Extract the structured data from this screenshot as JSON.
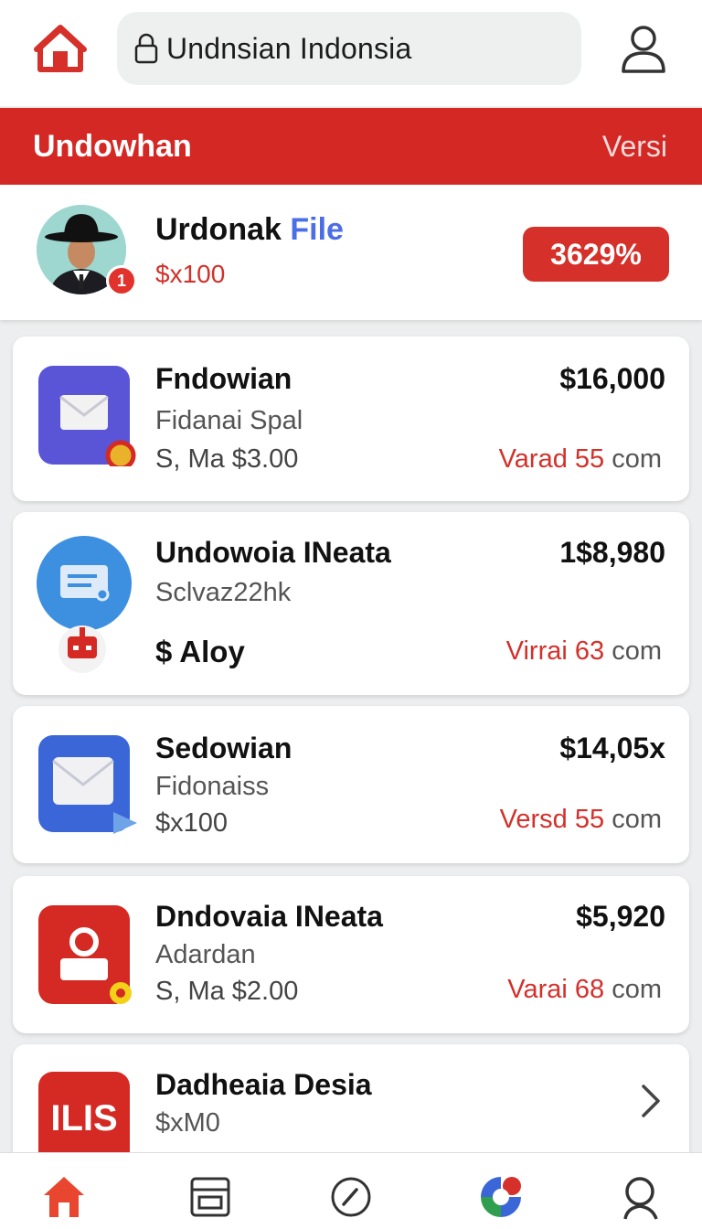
{
  "search": {
    "text": "Undnsian Indonsia"
  },
  "banner": {
    "title": "Undowhan",
    "right_label": "Versi"
  },
  "profile": {
    "name": "Urdonak",
    "name_highlight": "File",
    "sub": "$x100",
    "badge_count": "1",
    "percent": "3629%"
  },
  "items": [
    {
      "title": "Fndowian",
      "sub": "Fidanai Spal",
      "meta": "S, Ma  $3.00",
      "price": "$16,000",
      "status_red": "Varad 55",
      "status_grey": "com",
      "icon": "mail-icon",
      "color": "#5a55d6"
    },
    {
      "title": "Undowoia INeata",
      "sub": "Sclvaz22hk",
      "meta": "$ Aloy",
      "price": "1$8,980",
      "status_red": "Virrai 63",
      "status_grey": "com",
      "icon": "document-icon",
      "color": "#3d8fe0"
    },
    {
      "title": "Sedowian",
      "sub": "Fidonaiss",
      "meta": "$x100",
      "price": "$14,05x",
      "status_red": "Versd 55",
      "status_grey": "com",
      "icon": "mail-icon",
      "color": "#3a66d8"
    },
    {
      "title": "Dndovaia INeata",
      "sub": "Adardan",
      "meta": "S, Ma  $2.00",
      "price": "$5,920",
      "status_red": "Varai 68",
      "status_grey": "com",
      "icon": "user-pin-icon",
      "color": "#d42a23"
    },
    {
      "title": "Dadheaia Desia",
      "sub": "$xM0",
      "icon": "grid-logo-icon",
      "color": "#d42a23"
    }
  ],
  "colors": {
    "brand_red": "#d32824",
    "accent_blue": "#4b6ee6"
  },
  "nav": {
    "items": [
      "home-icon",
      "printer-icon",
      "compass-icon",
      "google-icon",
      "person-icon"
    ]
  }
}
